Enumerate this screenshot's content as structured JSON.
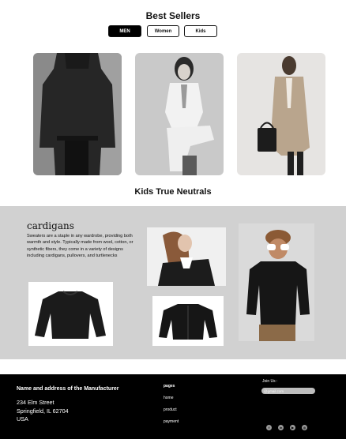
{
  "best_sellers": {
    "title": "Best Sellers",
    "tabs": [
      {
        "label": "MEN",
        "active": true
      },
      {
        "label": "Women",
        "active": false
      },
      {
        "label": "Kids",
        "active": false
      }
    ]
  },
  "kids_section": {
    "title": "Kids True Neutrals",
    "heading": "cardigans",
    "description": "Sweaters are a staple in any wardrobe, providing both warmth and style. Typically made from wool, cotton, or synthetic fibers, they come in a variety of designs including cardigans, pullovers, and turtlenecks",
    "band_color": "#d1d1d1"
  },
  "footer": {
    "manufacturer_title": "Name and address of the Manufacturer",
    "address_lines": [
      "234 Elm Street",
      "Springfield, IL 62704",
      "USA"
    ],
    "pages_heading": "pages",
    "links": [
      "home",
      "product",
      "payment"
    ],
    "join_label": "Join Us :",
    "email_placeholder": "@gmail.com",
    "social_icons": [
      "facebook-icon",
      "linkedin-icon",
      "youtube-icon",
      "instagram-icon"
    ]
  }
}
